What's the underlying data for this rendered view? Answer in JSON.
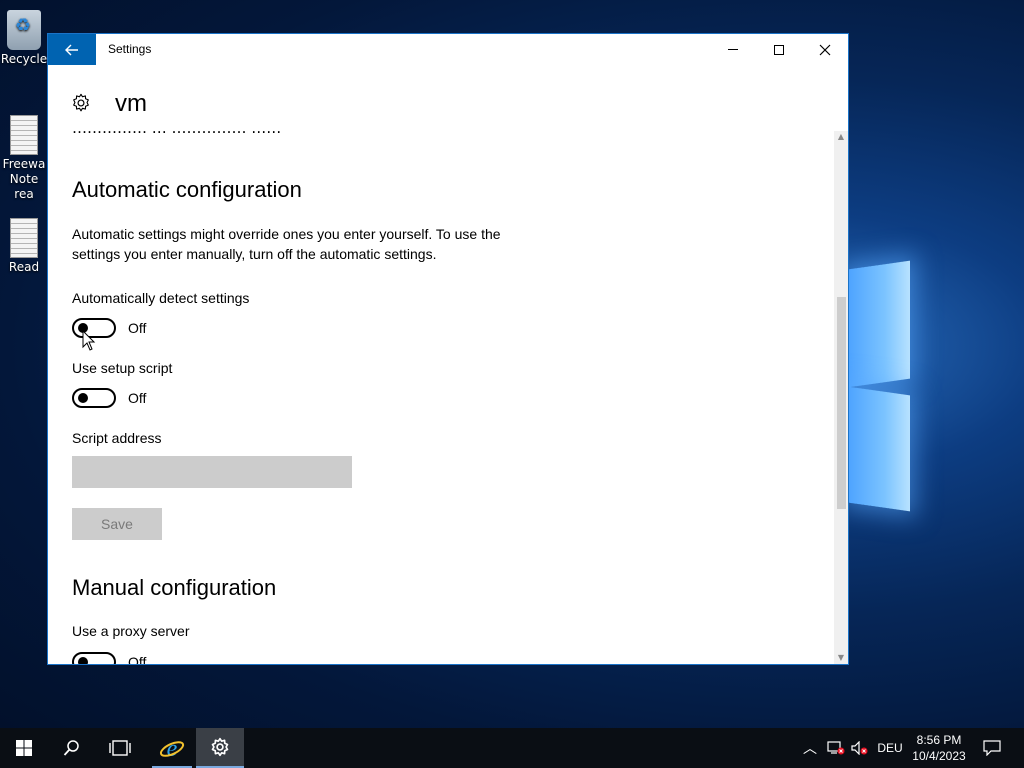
{
  "desktop": {
    "icons": [
      {
        "label": "Recycle"
      },
      {
        "label": "Freewa",
        "label2": "Note rea"
      },
      {
        "label": "Read"
      }
    ]
  },
  "window": {
    "title": "Settings",
    "page_title": "vm",
    "clipped_text": "…………… … …………… ……",
    "automatic": {
      "heading": "Automatic configuration",
      "description": "Automatic settings might override ones you enter yourself. To use the settings you enter manually, turn off the automatic settings.",
      "detect_label": "Automatically detect settings",
      "detect_state": "Off",
      "script_label": "Use setup script",
      "script_state": "Off",
      "address_label": "Script address",
      "address_value": "",
      "save_label": "Save"
    },
    "manual": {
      "heading": "Manual configuration",
      "proxy_label": "Use a proxy server",
      "proxy_state": "Off"
    }
  },
  "taskbar": {
    "language": "DEU",
    "time": "8:56 PM",
    "date": "10/4/2023"
  },
  "colors": {
    "accent": "#0063b1",
    "disabled": "#cccccc"
  }
}
